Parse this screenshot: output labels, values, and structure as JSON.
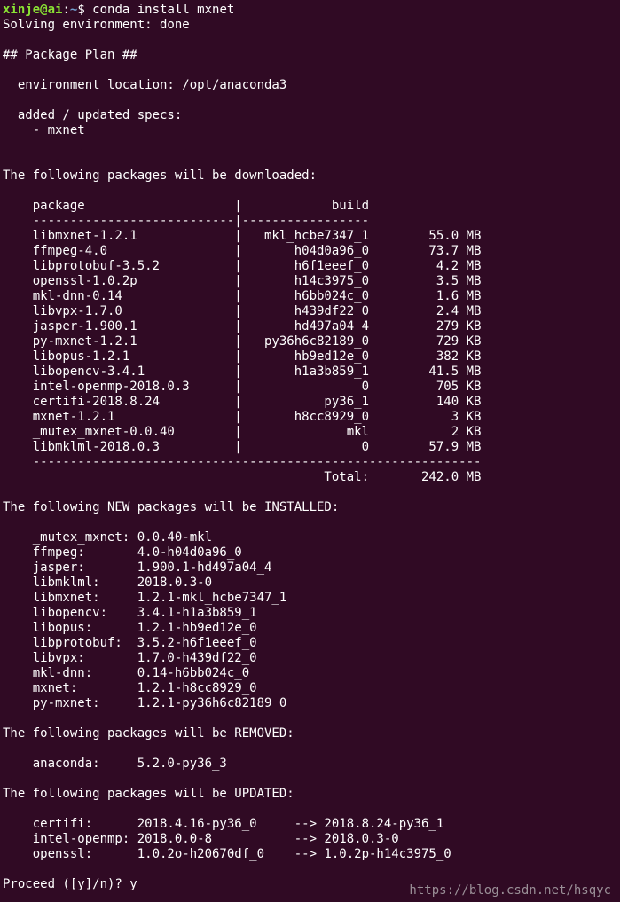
{
  "prompt": {
    "user": "xinje@ai",
    "colon": ":",
    "path": "~",
    "symbol": "$ ",
    "command": "conda install mxnet"
  },
  "lines": [
    "Solving environment: done",
    "",
    "## Package Plan ##",
    "",
    "  environment location: /opt/anaconda3",
    "",
    "  added / updated specs:",
    "    - mxnet",
    "",
    "",
    "The following packages will be downloaded:",
    "",
    "    package                    |            build",
    "    ---------------------------|-----------------",
    "    libmxnet-1.2.1             |   mkl_hcbe7347_1        55.0 MB",
    "    ffmpeg-4.0                 |       h04d0a96_0        73.7 MB",
    "    libprotobuf-3.5.2          |       h6f1eeef_0         4.2 MB",
    "    openssl-1.0.2p             |       h14c3975_0         3.5 MB",
    "    mkl-dnn-0.14               |       h6bb024c_0         1.6 MB",
    "    libvpx-1.7.0               |       h439df22_0         2.4 MB",
    "    jasper-1.900.1             |       hd497a04_4         279 KB",
    "    py-mxnet-1.2.1             |   py36h6c82189_0         729 KB",
    "    libopus-1.2.1              |       hb9ed12e_0         382 KB",
    "    libopencv-3.4.1            |       h1a3b859_1        41.5 MB",
    "    intel-openmp-2018.0.3      |                0         705 KB",
    "    certifi-2018.8.24          |           py36_1         140 KB",
    "    mxnet-1.2.1                |       h8cc8929_0           3 KB",
    "    _mutex_mxnet-0.0.40        |              mkl           2 KB",
    "    libmklml-2018.0.3          |                0        57.9 MB",
    "    ------------------------------------------------------------",
    "                                           Total:       242.0 MB",
    "",
    "The following NEW packages will be INSTALLED:",
    "",
    "    _mutex_mxnet: 0.0.40-mkl",
    "    ffmpeg:       4.0-h04d0a96_0",
    "    jasper:       1.900.1-hd497a04_4",
    "    libmklml:     2018.0.3-0",
    "    libmxnet:     1.2.1-mkl_hcbe7347_1",
    "    libopencv:    3.4.1-h1a3b859_1",
    "    libopus:      1.2.1-hb9ed12e_0",
    "    libprotobuf:  3.5.2-h6f1eeef_0",
    "    libvpx:       1.7.0-h439df22_0",
    "    mkl-dnn:      0.14-h6bb024c_0",
    "    mxnet:        1.2.1-h8cc8929_0",
    "    py-mxnet:     1.2.1-py36h6c82189_0",
    "",
    "The following packages will be REMOVED:",
    "",
    "    anaconda:     5.2.0-py36_3",
    "",
    "The following packages will be UPDATED:",
    "",
    "    certifi:      2018.4.16-py36_0     --> 2018.8.24-py36_1",
    "    intel-openmp: 2018.0.0-8           --> 2018.0.3-0",
    "    openssl:      1.0.2o-h20670df_0    --> 1.0.2p-h14c3975_0",
    "",
    "Proceed ([y]/n)? y"
  ],
  "watermark": "https://blog.csdn.net/hsqyc",
  "colors": {
    "background": "#300a24",
    "text": "#ffffff",
    "prompt_user": "#8ae234",
    "prompt_path": "#729fcf"
  }
}
